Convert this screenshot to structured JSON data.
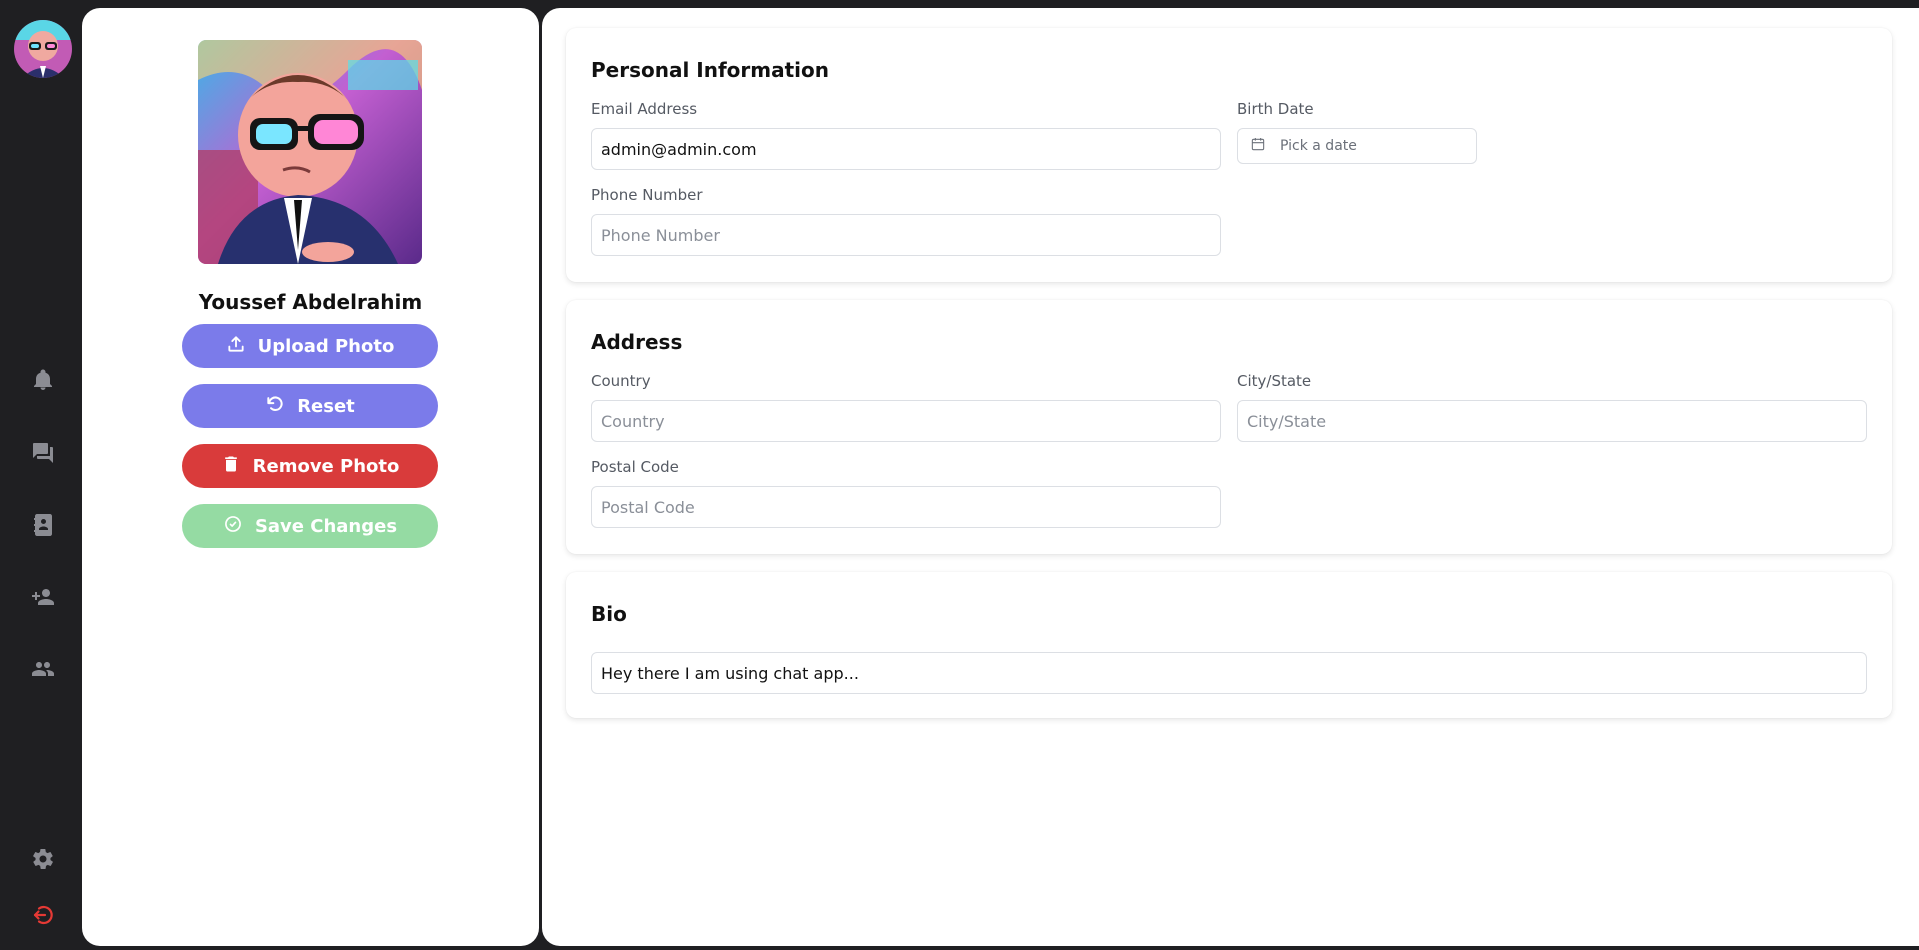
{
  "sidebar": {
    "items": [
      {
        "name": "notifications",
        "icon": "bell-icon"
      },
      {
        "name": "chats",
        "icon": "chat-icon"
      },
      {
        "name": "contacts",
        "icon": "contact-book-icon"
      },
      {
        "name": "add-friend",
        "icon": "person-add-icon"
      },
      {
        "name": "groups",
        "icon": "people-icon"
      },
      {
        "name": "settings",
        "icon": "gear-icon"
      },
      {
        "name": "logout",
        "icon": "logout-icon"
      }
    ]
  },
  "profile": {
    "name": "Youssef Abdelrahim",
    "upload_label": "Upload Photo",
    "reset_label": "Reset",
    "remove_label": "Remove Photo",
    "save_label": "Save Changes"
  },
  "personal": {
    "title": "Personal Information",
    "email_label": "Email Address",
    "email_value": "admin@admin.com",
    "birth_label": "Birth Date",
    "birth_placeholder": "Pick a date",
    "phone_label": "Phone Number",
    "phone_placeholder": "Phone Number"
  },
  "address": {
    "title": "Address",
    "country_label": "Country",
    "country_placeholder": "Country",
    "city_label": "City/State",
    "city_placeholder": "City/State",
    "postal_label": "Postal Code",
    "postal_placeholder": "Postal Code"
  },
  "bio": {
    "title": "Bio",
    "value": "Hey there I am using chat app..."
  },
  "colors": {
    "primary": "#7b7bea",
    "danger": "#d93b3b",
    "success_disabled": "#95dba3",
    "rail": "#1f1f22",
    "logout": "#e53935"
  }
}
